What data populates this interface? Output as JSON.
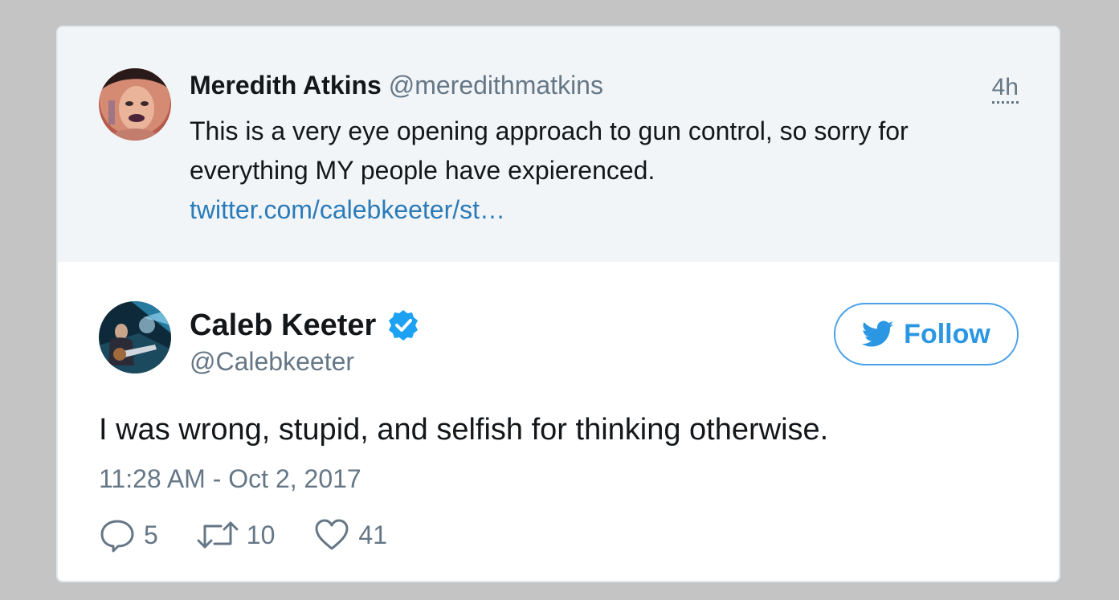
{
  "parent_tweet": {
    "name": "Meredith Atkins",
    "handle": "@meredithmatkins",
    "time": "4h",
    "text": "This is a very eye opening approach to gun control, so sorry for everything MY people have expierenced.",
    "link": "twitter.com/calebkeeter/st…"
  },
  "tweet": {
    "name": "Caleb Keeter",
    "handle": "@Calebkeeter",
    "verified": true,
    "follow_label": "Follow",
    "text": "I was wrong, stupid, and selfish for thinking otherwise.",
    "timestamp": "11:28 AM - Oct 2, 2017",
    "replies": "5",
    "retweets": "10",
    "likes": "41"
  },
  "colors": {
    "accent": "#1da1f2",
    "link": "#2b7bb9",
    "muted": "#657786",
    "parent_bg": "#f2f5f8"
  },
  "icons": {
    "verified": "verified-badge-icon",
    "follow": "twitter-bird-icon",
    "reply": "reply-icon",
    "retweet": "retweet-icon",
    "like": "heart-icon"
  }
}
